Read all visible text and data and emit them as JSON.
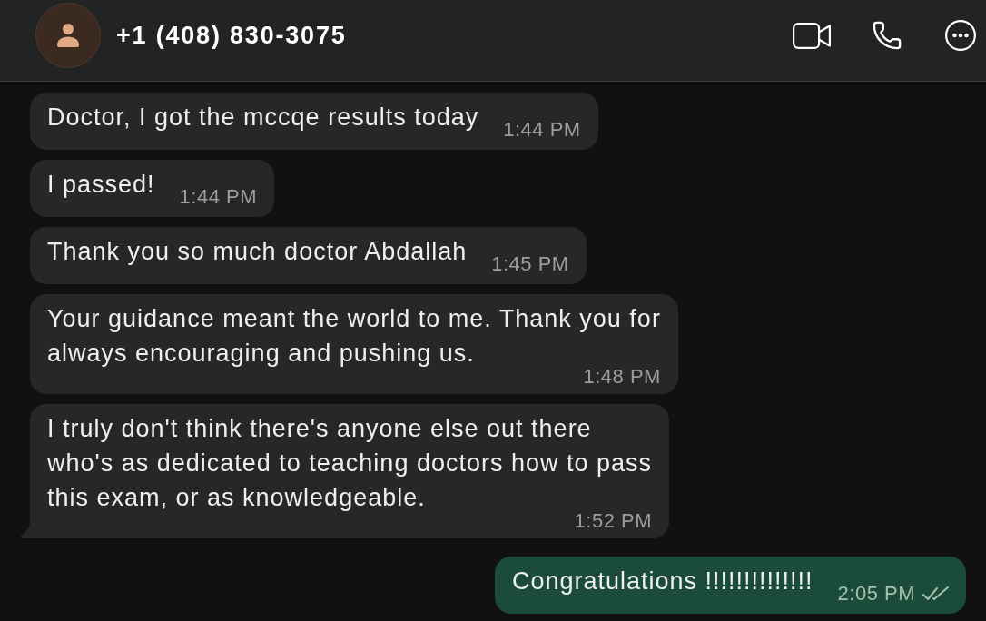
{
  "header": {
    "contact": "+1 (408) 830-3075"
  },
  "messages": [
    {
      "kind": "incoming",
      "text": "Doctor, I got the mccqe results today",
      "time": "1:44 PM",
      "tail": false
    },
    {
      "kind": "incoming",
      "text": "I passed!",
      "time": "1:44 PM",
      "tail": false
    },
    {
      "kind": "incoming",
      "text": "Thank you so much doctor Abdallah",
      "time": "1:45 PM",
      "tail": false
    },
    {
      "kind": "incoming",
      "text": "Your guidance meant the world to me. Thank you for\nalways encouraging and pushing us.",
      "time": "1:48 PM",
      "tail": false
    },
    {
      "kind": "incoming",
      "text": "I truly don't think there's anyone else out there\nwho's as dedicated to teaching doctors how to pass\nthis exam, or as knowledgeable.",
      "time": "1:52 PM",
      "tail": true
    },
    {
      "kind": "outgoing",
      "text": "Congratulations !!!!!!!!!!!!!!",
      "time": "2:05 PM",
      "delivered": true,
      "read": false,
      "tail": false
    }
  ]
}
